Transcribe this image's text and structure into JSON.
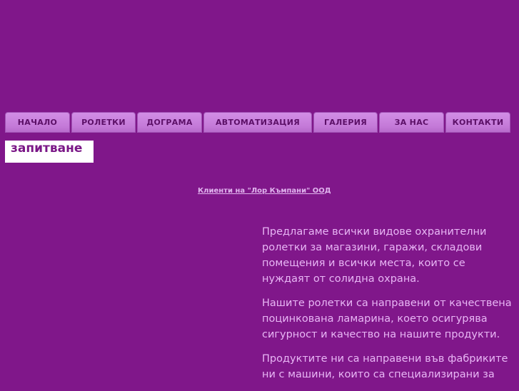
{
  "nav": {
    "items": [
      {
        "label": "НАЧАЛО"
      },
      {
        "label": "РОЛЕТКИ"
      },
      {
        "label": "ДОГРАМА"
      },
      {
        "label": "АВТОМАТИЗАЦИЯ"
      },
      {
        "label": "ГАЛЕРИЯ"
      },
      {
        "label": "ЗА НАС"
      },
      {
        "label": "КОНТАКТИ"
      }
    ]
  },
  "search": {
    "value": "запитване"
  },
  "clients_link": "Клиенти на \"Лор Къмпани\" ООД",
  "content": {
    "paragraphs": [
      "Предлагаме всички видове охранителни ролетки за магазини, гаражи, складови помещения и всички места, които се нуждаят от солидна охрана.",
      "Нашите ролетки са направени от качествена поцинкована ламарина, което осигурява сигурност и качество на нашите продукти.",
      "Продуктите ни са направени във фабриките ни с машини, които са специализирани за"
    ]
  }
}
